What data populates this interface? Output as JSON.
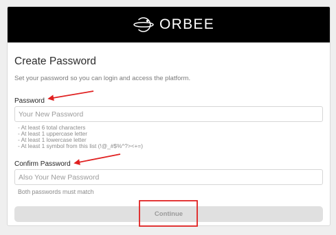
{
  "brand": {
    "name": "ORBEE",
    "icon": "orbit-logo-icon"
  },
  "form": {
    "title": "Create Password",
    "subtitle": "Set your password so you can login and access the platform.",
    "password": {
      "label": "Password",
      "value": "",
      "placeholder": "Your New Password",
      "rules": [
        "- At least 6 total characters",
        "- At least 1 uppercase letter",
        "- At least 1 lowercase letter",
        "- At least 1 symbol from this list (!@_#$%^?><+=)"
      ]
    },
    "confirm_password": {
      "label": "Confirm Password",
      "value": "",
      "placeholder": "Also Your New Password",
      "hint": "Both passwords must match"
    },
    "continue_label": "Continue"
  },
  "annotations": {
    "arrow_color": "#e02020",
    "highlight_color": "#e02020",
    "icons": [
      "annotation-arrow-icon",
      "annotation-highlight-box"
    ]
  },
  "colors": {
    "header_bg": "#000000",
    "page_bg": "#efefef",
    "button_bg": "#e0e0e0",
    "button_text": "#9a9a9a"
  }
}
